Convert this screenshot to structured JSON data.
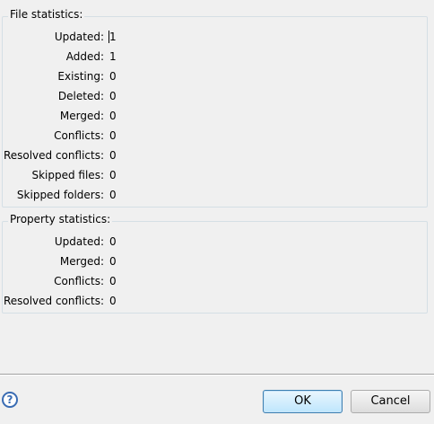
{
  "file_statistics": {
    "title": "File statistics:",
    "rows": [
      {
        "label": "Updated:",
        "value": "1"
      },
      {
        "label": "Added:",
        "value": "1"
      },
      {
        "label": "Existing:",
        "value": "0"
      },
      {
        "label": "Deleted:",
        "value": "0"
      },
      {
        "label": "Merged:",
        "value": "0"
      },
      {
        "label": "Conflicts:",
        "value": "0"
      },
      {
        "label": "Resolved conflicts:",
        "value": "0"
      },
      {
        "label": "Skipped files:",
        "value": "0"
      },
      {
        "label": "Skipped folders:",
        "value": "0"
      }
    ]
  },
  "property_statistics": {
    "title": "Property statistics:",
    "rows": [
      {
        "label": "Updated:",
        "value": "0"
      },
      {
        "label": "Merged:",
        "value": "0"
      },
      {
        "label": "Conflicts:",
        "value": "0"
      },
      {
        "label": "Resolved conflicts:",
        "value": "0"
      }
    ]
  },
  "footer": {
    "help_icon": "?",
    "ok_label": "OK",
    "cancel_label": "Cancel"
  }
}
